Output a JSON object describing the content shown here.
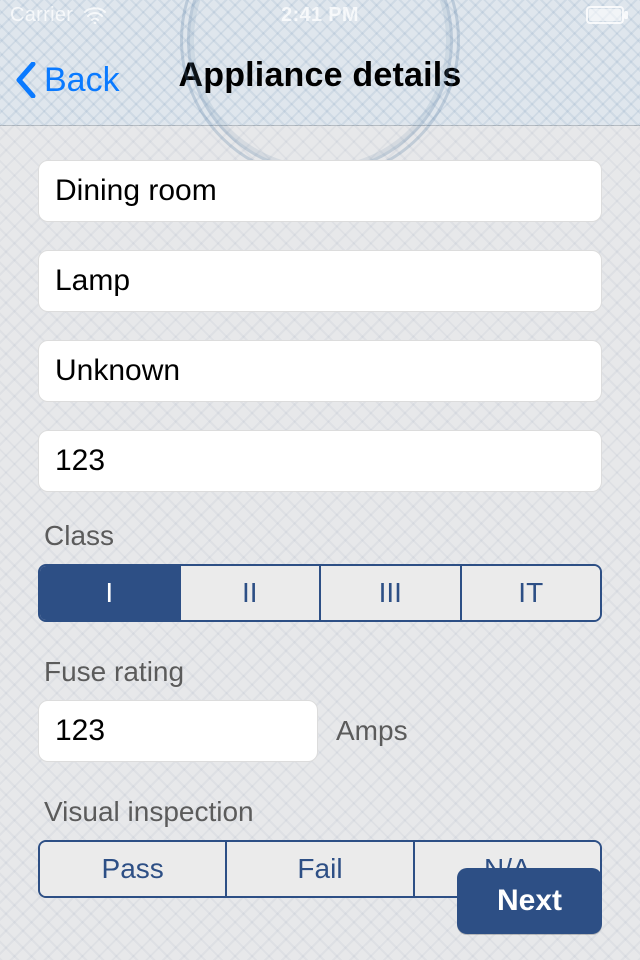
{
  "status": {
    "carrier": "Carrier",
    "time": "2:41 PM"
  },
  "nav": {
    "back_label": "Back",
    "title": "Appliance details"
  },
  "form": {
    "location": "Dining room",
    "appliance": "Lamp",
    "manufacturer": "Unknown",
    "serial": "123",
    "class_label": "Class",
    "class_options": [
      "I",
      "II",
      "III",
      "IT"
    ],
    "class_selected_index": 0,
    "fuse_label": "Fuse rating",
    "fuse_value": "123",
    "fuse_unit": "Amps",
    "visual_label": "Visual inspection",
    "visual_options": [
      "Pass",
      "Fail",
      "N/A"
    ],
    "visual_selected_index": -1
  },
  "actions": {
    "next": "Next"
  }
}
